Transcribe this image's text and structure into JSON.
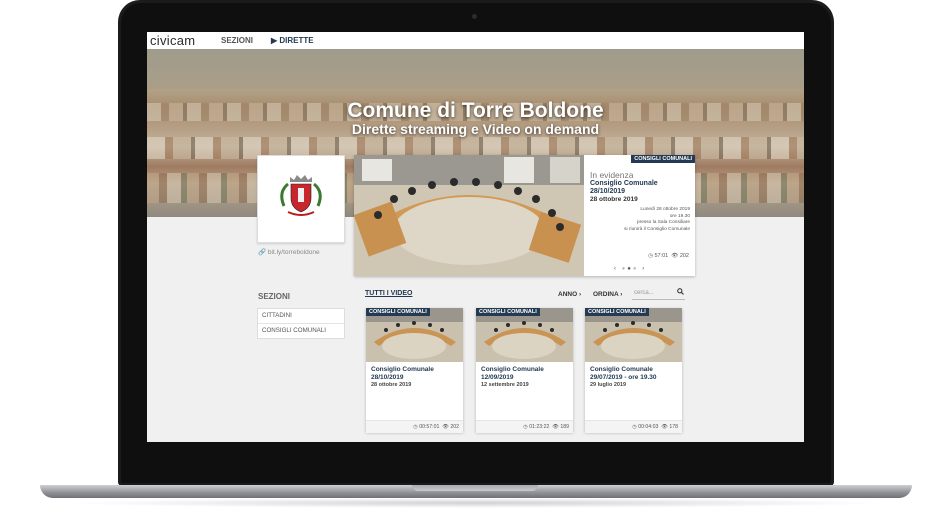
{
  "nav": {
    "logo": "civicam",
    "sezioni": "SEZIONI",
    "dirette": "▶ DIRETTE"
  },
  "hero": {
    "title": "Comune di Torre Boldone",
    "subtitle": "Dirette streaming e Video on demand"
  },
  "profile": {
    "link": "bit.ly/torreboldone"
  },
  "featured": {
    "tag": "CONSIGLI COMUNALI",
    "heading": "In evidenza",
    "title": "Consiglio Comunale 28/10/2019",
    "date": "28 ottobre 2019",
    "description_1": "Lunedì 28 ottobre 2019",
    "description_2": "ore 19.30",
    "description_3": "presso la Sala Consiliare",
    "description_4": "si riunirà il Consiglio Comunale",
    "duration": "57:01",
    "views": "202",
    "nav_prev": "‹",
    "nav_next": "›"
  },
  "sections": {
    "title": "SEZIONI",
    "items": [
      "CITTADINI",
      "CONSIGLI COMUNALI"
    ]
  },
  "videos_toolbar": {
    "all": "TUTTI I VIDEO",
    "year": "ANNO",
    "order": "ORDINA",
    "search_placeholder": "cerca..."
  },
  "videos": [
    {
      "tag": "CONSIGLI COMUNALI",
      "title": "Consiglio Comunale 28/10/2019",
      "date": "28 ottobre 2019",
      "duration": "00:57:01",
      "views": "202"
    },
    {
      "tag": "CONSIGLI COMUNALI",
      "title": "Consiglio Comunale 12/09/2019",
      "date": "12 settembre 2019",
      "duration": "01:23:22",
      "views": "189"
    },
    {
      "tag": "CONSIGLI COMUNALI",
      "title": "Consiglio Comunale 29/07/2019 - ore 19.30",
      "date": "29 luglio 2019",
      "duration": "00:04:03",
      "views": "178"
    }
  ],
  "colors": {
    "navy": "#233a52",
    "accent": "#1e9fd0"
  }
}
